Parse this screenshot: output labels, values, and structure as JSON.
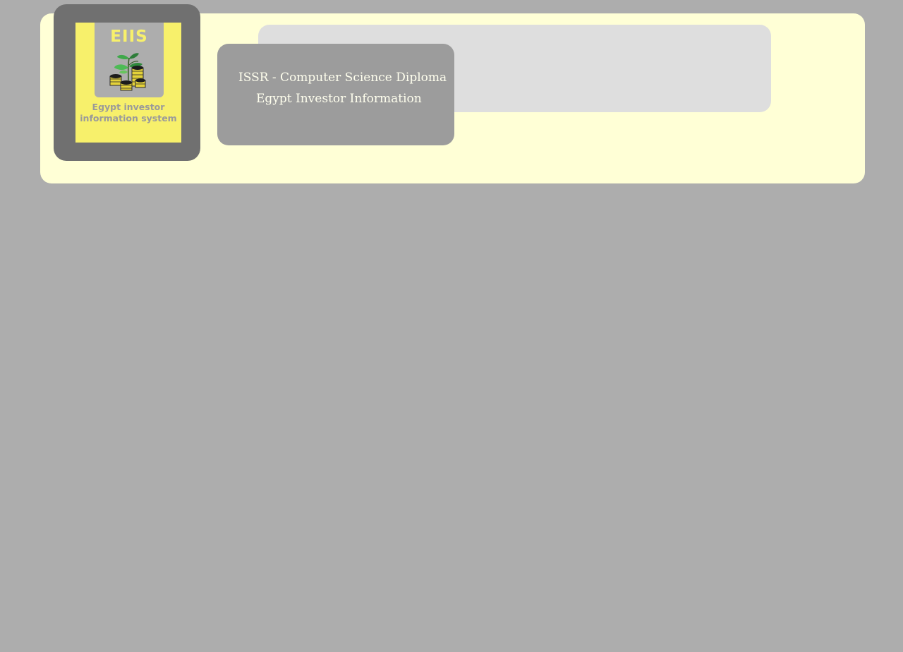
{
  "logo": {
    "abbreviation": "EIIS",
    "caption": "Egypt investor information system",
    "art_icon": "plant-and-coins-icon",
    "colors": {
      "frame": "#707070",
      "card": "#f7f06b",
      "inner": "#adadad",
      "caption": "#9a9a9a"
    }
  },
  "header": {
    "title_line_1": "ISSR - Computer Science Diploma",
    "title_line_2": "Egypt Investor Information"
  },
  "colors": {
    "page_background": "#adadad",
    "header_panel": "#ffffd6",
    "light_bar": "#dedede",
    "title_box": "#9c9c9c",
    "title_text": "#ffffee"
  }
}
